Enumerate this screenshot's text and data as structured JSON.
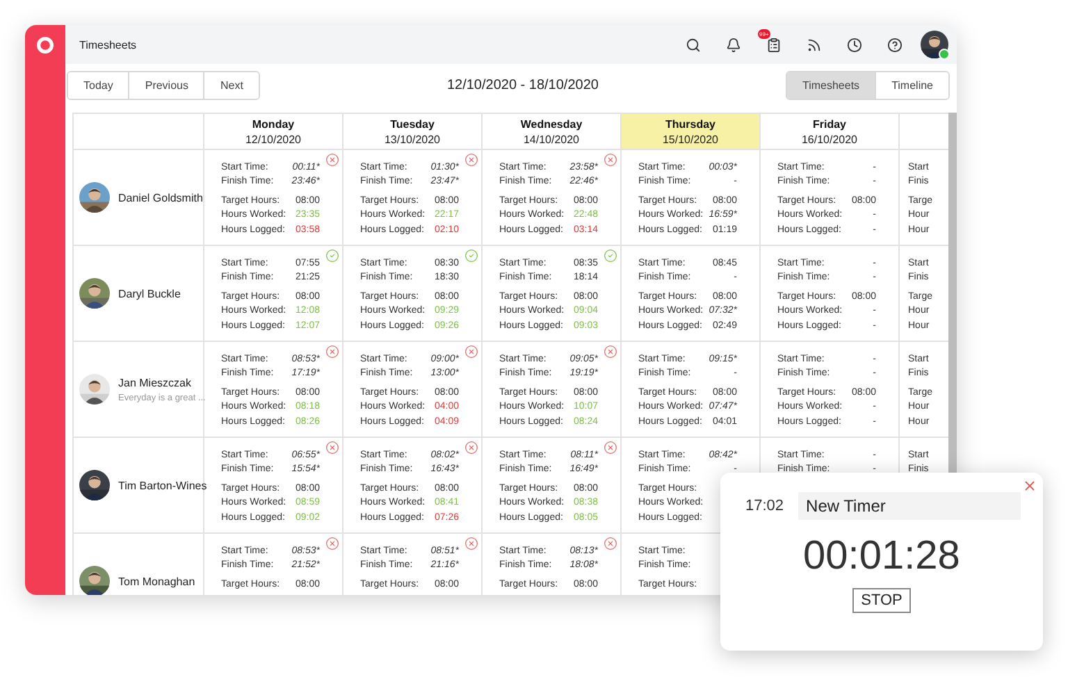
{
  "app_title": "Timesheets",
  "notification_badge": "99+",
  "nav_buttons": [
    "Today",
    "Previous",
    "Next"
  ],
  "date_range": "12/10/2020 - 18/10/2020",
  "view_tabs": [
    {
      "label": "Timesheets",
      "selected": true
    },
    {
      "label": "Timeline",
      "selected": false
    }
  ],
  "days": [
    {
      "name": "Monday",
      "date": "12/10/2020",
      "today": false
    },
    {
      "name": "Tuesday",
      "date": "13/10/2020",
      "today": false
    },
    {
      "name": "Wednesday",
      "date": "14/10/2020",
      "today": false
    },
    {
      "name": "Thursday",
      "date": "15/10/2020",
      "today": true
    },
    {
      "name": "Friday",
      "date": "16/10/2020",
      "today": false
    },
    {
      "today": false
    }
  ],
  "rows": [
    {
      "name": "Daniel Goldsmith",
      "cells": [
        {
          "kind": "flagged",
          "lines": [
            {
              "label": "Start Time:",
              "value": "00:11*",
              "italic": true
            },
            {
              "label": "Finish Time:",
              "value": "23:46*",
              "italic": true
            },
            {
              "label": "Target Hours:",
              "value": "08:00"
            },
            {
              "label": "Hours Worked:",
              "value": "23:35",
              "color": "#7cc243"
            },
            {
              "label": "Hours Logged:",
              "value": "03:58",
              "color": "#e53935"
            }
          ]
        },
        {
          "kind": "flagged",
          "lines": [
            {
              "label": "Start Time:",
              "value": "01:30*",
              "italic": true
            },
            {
              "label": "Finish Time:",
              "value": "23:47*",
              "italic": true
            },
            {
              "label": "Target Hours:",
              "value": "08:00"
            },
            {
              "label": "Hours Worked:",
              "value": "22:17",
              "color": "#7cc243"
            },
            {
              "label": "Hours Logged:",
              "value": "02:10",
              "color": "#e53935"
            }
          ]
        },
        {
          "kind": "flagged",
          "lines": [
            {
              "label": "Start Time:",
              "value": "23:58*",
              "italic": true
            },
            {
              "label": "Finish Time:",
              "value": "22:46*",
              "italic": true
            },
            {
              "label": "Target Hours:",
              "value": "08:00"
            },
            {
              "label": "Hours Worked:",
              "value": "22:48",
              "color": "#7cc243"
            },
            {
              "label": "Hours Logged:",
              "value": "03:14",
              "color": "#e53935"
            }
          ]
        },
        {
          "lines": [
            {
              "label": "Start Time:",
              "value": "00:03*",
              "italic": true
            },
            {
              "label": "Finish Time:",
              "value": "-"
            },
            {
              "label": "Target Hours:",
              "value": "08:00"
            },
            {
              "label": "Hours Worked:",
              "value": "16:59*",
              "italic": true
            },
            {
              "label": "Hours Logged:",
              "value": "01:19"
            }
          ]
        },
        {
          "lines": [
            {
              "label": "Start Time:",
              "value": "-"
            },
            {
              "label": "Finish Time:",
              "value": "-"
            },
            {
              "label": "Target Hours:",
              "value": "08:00"
            },
            {
              "label": "Hours Worked:",
              "value": "-"
            },
            {
              "label": "Hours Logged:",
              "value": "-"
            }
          ]
        },
        {
          "lines": [
            {
              "label": "Start"
            },
            {
              "label": "Finis"
            },
            {
              "label": "Targe"
            },
            {
              "label": "Hour"
            },
            {
              "label": "Hour"
            }
          ]
        }
      ]
    },
    {
      "name": "Daryl Buckle",
      "cells": [
        {
          "kind": "approved",
          "lines": [
            {
              "label": "Start Time:",
              "value": "07:55"
            },
            {
              "label": "Finish Time:",
              "value": "21:25"
            },
            {
              "label": "Target Hours:",
              "value": "08:00"
            },
            {
              "label": "Hours Worked:",
              "value": "12:08",
              "color": "#7cc243"
            },
            {
              "label": "Hours Logged:",
              "value": "12:07",
              "color": "#7cc243"
            }
          ]
        },
        {
          "kind": "approved",
          "lines": [
            {
              "label": "Start Time:",
              "value": "08:30"
            },
            {
              "label": "Finish Time:",
              "value": "18:30"
            },
            {
              "label": "Target Hours:",
              "value": "08:00"
            },
            {
              "label": "Hours Worked:",
              "value": "09:29",
              "color": "#7cc243"
            },
            {
              "label": "Hours Logged:",
              "value": "09:26",
              "color": "#7cc243"
            }
          ]
        },
        {
          "kind": "approved",
          "lines": [
            {
              "label": "Start Time:",
              "value": "08:35"
            },
            {
              "label": "Finish Time:",
              "value": "18:14"
            },
            {
              "label": "Target Hours:",
              "value": "08:00"
            },
            {
              "label": "Hours Worked:",
              "value": "09:04",
              "color": "#7cc243"
            },
            {
              "label": "Hours Logged:",
              "value": "09:03",
              "color": "#7cc243"
            }
          ]
        },
        {
          "lines": [
            {
              "label": "Start Time:",
              "value": "08:45"
            },
            {
              "label": "Finish Time:",
              "value": "-"
            },
            {
              "label": "Target Hours:",
              "value": "08:00"
            },
            {
              "label": "Hours Worked:",
              "value": "07:32*",
              "italic": true
            },
            {
              "label": "Hours Logged:",
              "value": "02:49"
            }
          ]
        },
        {
          "lines": [
            {
              "label": "Start Time:",
              "value": "-"
            },
            {
              "label": "Finish Time:",
              "value": "-"
            },
            {
              "label": "Target Hours:",
              "value": "08:00"
            },
            {
              "label": "Hours Worked:",
              "value": "-"
            },
            {
              "label": "Hours Logged:",
              "value": "-"
            }
          ]
        },
        {
          "lines": [
            {
              "label": "Start"
            },
            {
              "label": "Finis"
            },
            {
              "label": "Targe"
            },
            {
              "label": "Hour"
            },
            {
              "label": "Hour"
            }
          ]
        }
      ]
    },
    {
      "name": "Jan Mieszczak",
      "note": "Everyday is a great ...",
      "cells": [
        {
          "kind": "flagged",
          "lines": [
            {
              "label": "Start Time:",
              "value": "08:53*",
              "italic": true
            },
            {
              "label": "Finish Time:",
              "value": "17:19*",
              "italic": true
            },
            {
              "label": "Target Hours:",
              "value": "08:00"
            },
            {
              "label": "Hours Worked:",
              "value": "08:18",
              "color": "#7cc243"
            },
            {
              "label": "Hours Logged:",
              "value": "08:26",
              "color": "#7cc243"
            }
          ]
        },
        {
          "kind": "flagged",
          "lines": [
            {
              "label": "Start Time:",
              "value": "09:00*",
              "italic": true
            },
            {
              "label": "Finish Time:",
              "value": "13:00*",
              "italic": true
            },
            {
              "label": "Target Hours:",
              "value": "08:00"
            },
            {
              "label": "Hours Worked:",
              "value": "04:00",
              "color": "#e53935"
            },
            {
              "label": "Hours Logged:",
              "value": "04:09",
              "color": "#e53935"
            }
          ]
        },
        {
          "kind": "flagged",
          "lines": [
            {
              "label": "Start Time:",
              "value": "09:05*",
              "italic": true
            },
            {
              "label": "Finish Time:",
              "value": "19:19*",
              "italic": true
            },
            {
              "label": "Target Hours:",
              "value": "08:00"
            },
            {
              "label": "Hours Worked:",
              "value": "10:07",
              "color": "#7cc243"
            },
            {
              "label": "Hours Logged:",
              "value": "08:24",
              "color": "#7cc243"
            }
          ]
        },
        {
          "lines": [
            {
              "label": "Start Time:",
              "value": "09:15*",
              "italic": true
            },
            {
              "label": "Finish Time:",
              "value": "-"
            },
            {
              "label": "Target Hours:",
              "value": "08:00"
            },
            {
              "label": "Hours Worked:",
              "value": "07:47*",
              "italic": true
            },
            {
              "label": "Hours Logged:",
              "value": "04:01"
            }
          ]
        },
        {
          "lines": [
            {
              "label": "Start Time:",
              "value": "-"
            },
            {
              "label": "Finish Time:",
              "value": "-"
            },
            {
              "label": "Target Hours:",
              "value": "08:00"
            },
            {
              "label": "Hours Worked:",
              "value": "-"
            },
            {
              "label": "Hours Logged:",
              "value": "-"
            }
          ]
        },
        {
          "lines": [
            {
              "label": "Start"
            },
            {
              "label": "Finis"
            },
            {
              "label": "Targe"
            },
            {
              "label": "Hour"
            },
            {
              "label": "Hour"
            }
          ]
        }
      ]
    },
    {
      "name": "Tim Barton-Wines",
      "cells": [
        {
          "kind": "flagged",
          "lines": [
            {
              "label": "Start Time:",
              "value": "06:55*",
              "italic": true
            },
            {
              "label": "Finish Time:",
              "value": "15:54*",
              "italic": true
            },
            {
              "label": "Target Hours:",
              "value": "08:00"
            },
            {
              "label": "Hours Worked:",
              "value": "08:59",
              "color": "#7cc243"
            },
            {
              "label": "Hours Logged:",
              "value": "09:02",
              "color": "#7cc243"
            }
          ]
        },
        {
          "kind": "flagged",
          "lines": [
            {
              "label": "Start Time:",
              "value": "08:02*",
              "italic": true
            },
            {
              "label": "Finish Time:",
              "value": "16:43*",
              "italic": true
            },
            {
              "label": "Target Hours:",
              "value": "08:00"
            },
            {
              "label": "Hours Worked:",
              "value": "08:41",
              "color": "#7cc243"
            },
            {
              "label": "Hours Logged:",
              "value": "07:26",
              "color": "#e53935"
            }
          ]
        },
        {
          "kind": "flagged",
          "lines": [
            {
              "label": "Start Time:",
              "value": "08:11*",
              "italic": true
            },
            {
              "label": "Finish Time:",
              "value": "16:49*",
              "italic": true
            },
            {
              "label": "Target Hours:",
              "value": "08:00"
            },
            {
              "label": "Hours Worked:",
              "value": "08:38",
              "color": "#7cc243"
            },
            {
              "label": "Hours Logged:",
              "value": "08:05",
              "color": "#7cc243"
            }
          ]
        },
        {
          "lines": [
            {
              "label": "Start Time:",
              "value": "08:42*",
              "italic": true
            },
            {
              "label": "Finish Time:",
              "value": "-"
            },
            {
              "label": "Target Hours:"
            },
            {
              "label": "Hours Worked:"
            },
            {
              "label": "Hours Logged:"
            }
          ]
        },
        {
          "lines": [
            {
              "label": "Start Time:",
              "value": "-"
            },
            {
              "label": "Finish Time:",
              "value": "-"
            }
          ]
        },
        {
          "lines": [
            {
              "label": "Start"
            },
            {
              "label": "Finis"
            }
          ]
        }
      ]
    },
    {
      "name": "Tom Monaghan",
      "cells": [
        {
          "kind": "flagged",
          "lines": [
            {
              "label": "Start Time:",
              "value": "08:53*",
              "italic": true
            },
            {
              "label": "Finish Time:",
              "value": "21:52*",
              "italic": true
            },
            {
              "label": "Target Hours:",
              "value": "08:00"
            }
          ]
        },
        {
          "kind": "flagged",
          "lines": [
            {
              "label": "Start Time:",
              "value": "08:51*",
              "italic": true
            },
            {
              "label": "Finish Time:",
              "value": "21:16*",
              "italic": true
            },
            {
              "label": "Target Hours:",
              "value": "08:00"
            }
          ]
        },
        {
          "kind": "flagged",
          "lines": [
            {
              "label": "Start Time:",
              "value": "08:13*",
              "italic": true
            },
            {
              "label": "Finish Time:",
              "value": "18:08*",
              "italic": true
            },
            {
              "label": "Target Hours:",
              "value": "08:00"
            }
          ]
        },
        {
          "lines": [
            {
              "label": "Start Time:"
            },
            {
              "label": "Finish Time:"
            },
            {
              "label": "Target Hours:"
            }
          ]
        },
        {},
        {}
      ]
    }
  ],
  "timer": {
    "time": "17:02",
    "title": "New Timer",
    "elapsed": "00:01:28",
    "button": "STOP"
  }
}
